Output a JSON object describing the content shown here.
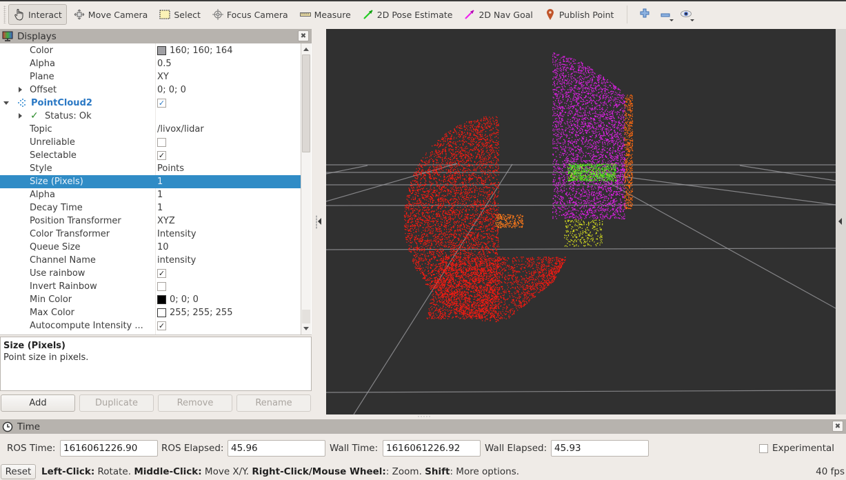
{
  "toolbar": {
    "tools": [
      {
        "label": "Interact",
        "icon": "hand-pointer-icon",
        "active": true
      },
      {
        "label": "Move Camera",
        "icon": "move-camera-icon",
        "active": false
      },
      {
        "label": "Select",
        "icon": "select-rectangle-icon",
        "active": false
      },
      {
        "label": "Focus Camera",
        "icon": "focus-camera-icon",
        "active": false
      },
      {
        "label": "Measure",
        "icon": "ruler-icon",
        "active": false
      },
      {
        "label": "2D Pose Estimate",
        "icon": "green-arrow-icon",
        "active": false
      },
      {
        "label": "2D Nav Goal",
        "icon": "magenta-arrow-icon",
        "active": false
      },
      {
        "label": "Publish Point",
        "icon": "map-pin-icon",
        "active": false
      }
    ],
    "extra": [
      "plus-icon",
      "minus-icon",
      "eye-icon"
    ]
  },
  "displays": {
    "title": "Displays",
    "rows": [
      {
        "name": "Color",
        "value": "160; 160; 164",
        "swatch": "#a0a0a4"
      },
      {
        "name": "Alpha",
        "value": "0.5"
      },
      {
        "name": "Plane",
        "value": "XY"
      },
      {
        "name": "Offset",
        "value": "0; 0; 0",
        "expander": "collapsed"
      },
      {
        "name": "PointCloud2",
        "checkbox": true,
        "expander": "expanded",
        "kind": "display"
      },
      {
        "name": "Status: Ok",
        "expander": "collapsed",
        "kind": "status"
      },
      {
        "name": "Topic",
        "value": "/livox/lidar"
      },
      {
        "name": "Unreliable",
        "checkbox": false
      },
      {
        "name": "Selectable",
        "checkbox": true
      },
      {
        "name": "Style",
        "value": "Points"
      },
      {
        "name": "Size (Pixels)",
        "value": "1",
        "selected": true
      },
      {
        "name": "Alpha",
        "value": "1"
      },
      {
        "name": "Decay Time",
        "value": "1"
      },
      {
        "name": "Position Transformer",
        "value": "XYZ"
      },
      {
        "name": "Color Transformer",
        "value": "Intensity"
      },
      {
        "name": "Queue Size",
        "value": "10"
      },
      {
        "name": "Channel Name",
        "value": "intensity"
      },
      {
        "name": "Use rainbow",
        "checkbox": true
      },
      {
        "name": "Invert Rainbow",
        "checkbox": false
      },
      {
        "name": "Min Color",
        "value": "0; 0; 0",
        "swatch": "#000000"
      },
      {
        "name": "Max Color",
        "value": "255; 255; 255",
        "swatch": "#ffffff"
      },
      {
        "name": "Autocompute Intensity ...",
        "checkbox": true
      }
    ],
    "description": {
      "title": "Size (Pixels)",
      "text": "Point size in pixels."
    },
    "buttons": [
      {
        "label": "Add",
        "enabled": true
      },
      {
        "label": "Duplicate",
        "enabled": false
      },
      {
        "label": "Remove",
        "enabled": false
      },
      {
        "label": "Rename",
        "enabled": false
      }
    ]
  },
  "time": {
    "title": "Time",
    "ros_time_label": "ROS Time:",
    "ros_time": "1616061226.90",
    "ros_elapsed_label": "ROS Elapsed:",
    "ros_elapsed": "45.96",
    "wall_time_label": "Wall Time:",
    "wall_time": "1616061226.92",
    "wall_elapsed_label": "Wall Elapsed:",
    "wall_elapsed": "45.93",
    "experimental_label": "Experimental",
    "experimental": false
  },
  "statusbar": {
    "reset_label": "Reset",
    "hint": [
      {
        "b": "Left-Click:",
        "t": " Rotate. "
      },
      {
        "b": "Middle-Click:",
        "t": " Move X/Y. "
      },
      {
        "b": "Right-Click/Mouse Wheel:",
        "t": ": Zoom. "
      },
      {
        "b": "Shift",
        "t": ": More options."
      }
    ],
    "fps": "40 fps"
  },
  "colors": {
    "selection": "#308cc6",
    "view_bg": "#303030",
    "grid": "#a0a0a4"
  }
}
